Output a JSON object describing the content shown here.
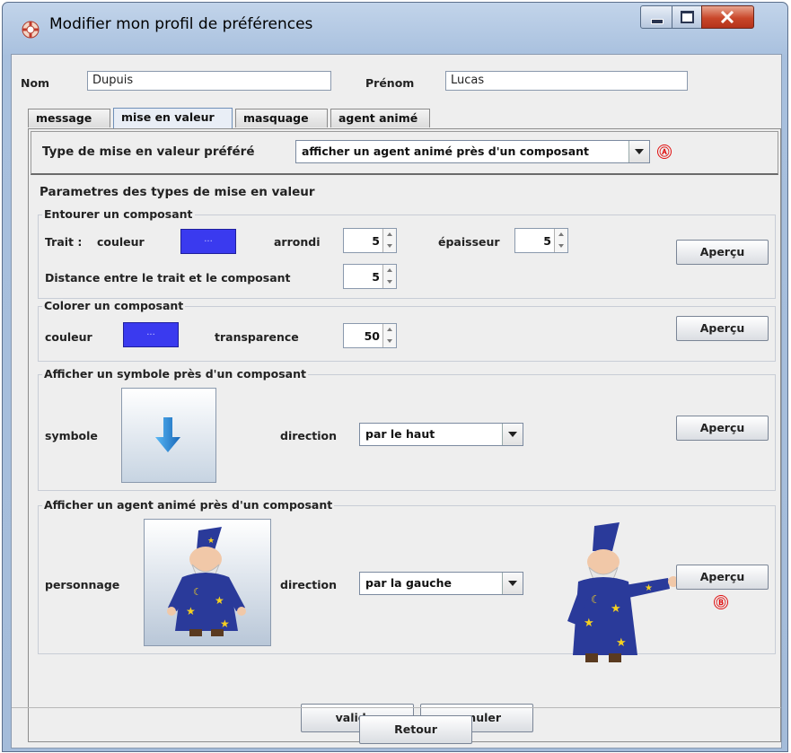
{
  "window": {
    "title": "Modifier mon profil de préférences",
    "icon": "app-lifebuoy-icon",
    "controls": [
      "minimize-icon",
      "maximize-icon",
      "close-icon"
    ]
  },
  "identity": {
    "nom_label": "Nom",
    "nom_value": "Dupuis",
    "prenom_label": "Prénom",
    "prenom_value": "Lucas"
  },
  "tabs": [
    {
      "label": "message",
      "active": false
    },
    {
      "label": "mise en valeur",
      "active": true
    },
    {
      "label": "masquage",
      "active": false
    },
    {
      "label": "agent animé",
      "active": false
    }
  ],
  "type_pref": {
    "label": "Type de mise en valeur préféré",
    "selected": "afficher un agent animé près d'un composant",
    "marker": "Ⓐ"
  },
  "params_title": "Parametres des types de mise en valeur",
  "entourer": {
    "title": "Entourer un composant",
    "trait_label": "Trait :",
    "couleur_label": "couleur",
    "color_button": "...",
    "arrondi_label": "arrondi",
    "arrondi_value": "5",
    "epaisseur_label": "épaisseur",
    "epaisseur_value": "5",
    "distance_label": "Distance entre le trait et le composant",
    "distance_value": "5",
    "apercu": "Aperçu"
  },
  "colorer": {
    "title": "Colorer un composant",
    "couleur_label": "couleur",
    "color_button": "...",
    "transparence_label": "transparence",
    "transparence_value": "50",
    "apercu": "Aperçu"
  },
  "symbole": {
    "title": "Afficher un symbole près d'un composant",
    "symbole_label": "symbole",
    "icon": "arrow-down-icon",
    "direction_label": "direction",
    "direction_value": "par le haut",
    "apercu": "Aperçu"
  },
  "agent": {
    "title": "Afficher un agent animé près d'un composant",
    "personnage_label": "personnage",
    "icon": "wizard-character-icon",
    "direction_label": "direction",
    "direction_value": "par la gauche",
    "apercu": "Aperçu",
    "marker": "Ⓑ"
  },
  "actions": {
    "valider": "valider",
    "annuler": "annuler",
    "retour": "Retour"
  },
  "colors": {
    "highlight_blue": "#3a3aef",
    "marker_red": "#e01010",
    "arrow_blue": "#1e88d8",
    "wizard_robe": "#2a3a9a"
  }
}
